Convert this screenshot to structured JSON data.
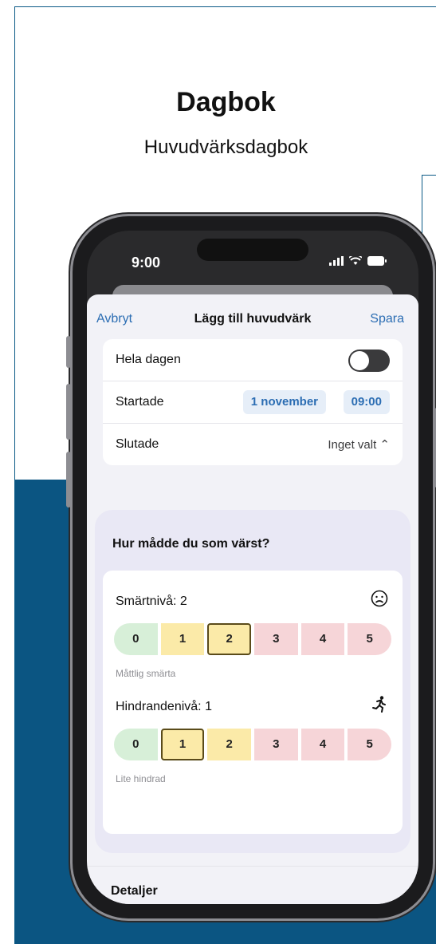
{
  "header": {
    "title": "Dagbok",
    "subtitle": "Huvudvärksdagbok"
  },
  "status_bar": {
    "time": "9:00"
  },
  "nav": {
    "cancel": "Avbryt",
    "title": "Lägg till huvudvärk",
    "save": "Spara"
  },
  "form": {
    "all_day_label": "Hela dagen",
    "all_day_on": false,
    "started_label": "Startade",
    "started_date": "1 november",
    "started_time": "09:00",
    "ended_label": "Slutade",
    "ended_value": "Inget valt ⌃"
  },
  "assessment": {
    "question": "Hur mådde du som värst?",
    "pain": {
      "label": "Smärtnivå: 2",
      "icon": "frown-icon",
      "values": [
        "0",
        "1",
        "2",
        "3",
        "4",
        "5"
      ],
      "selected": 2,
      "caption": "Måttlig smärta"
    },
    "hindrance": {
      "label": "Hindrandenivå: 1",
      "icon": "running-person-icon",
      "values": [
        "0",
        "1",
        "2",
        "3",
        "4",
        "5"
      ],
      "selected": 1,
      "caption": "Lite hindrad"
    }
  },
  "details_label": "Detaljer",
  "colors": {
    "brand_blue": "#0b5582",
    "link_blue": "#2b6db3",
    "green": "#d7efd8",
    "yellow": "#fbeaa8",
    "red": "#f6d5d8"
  }
}
